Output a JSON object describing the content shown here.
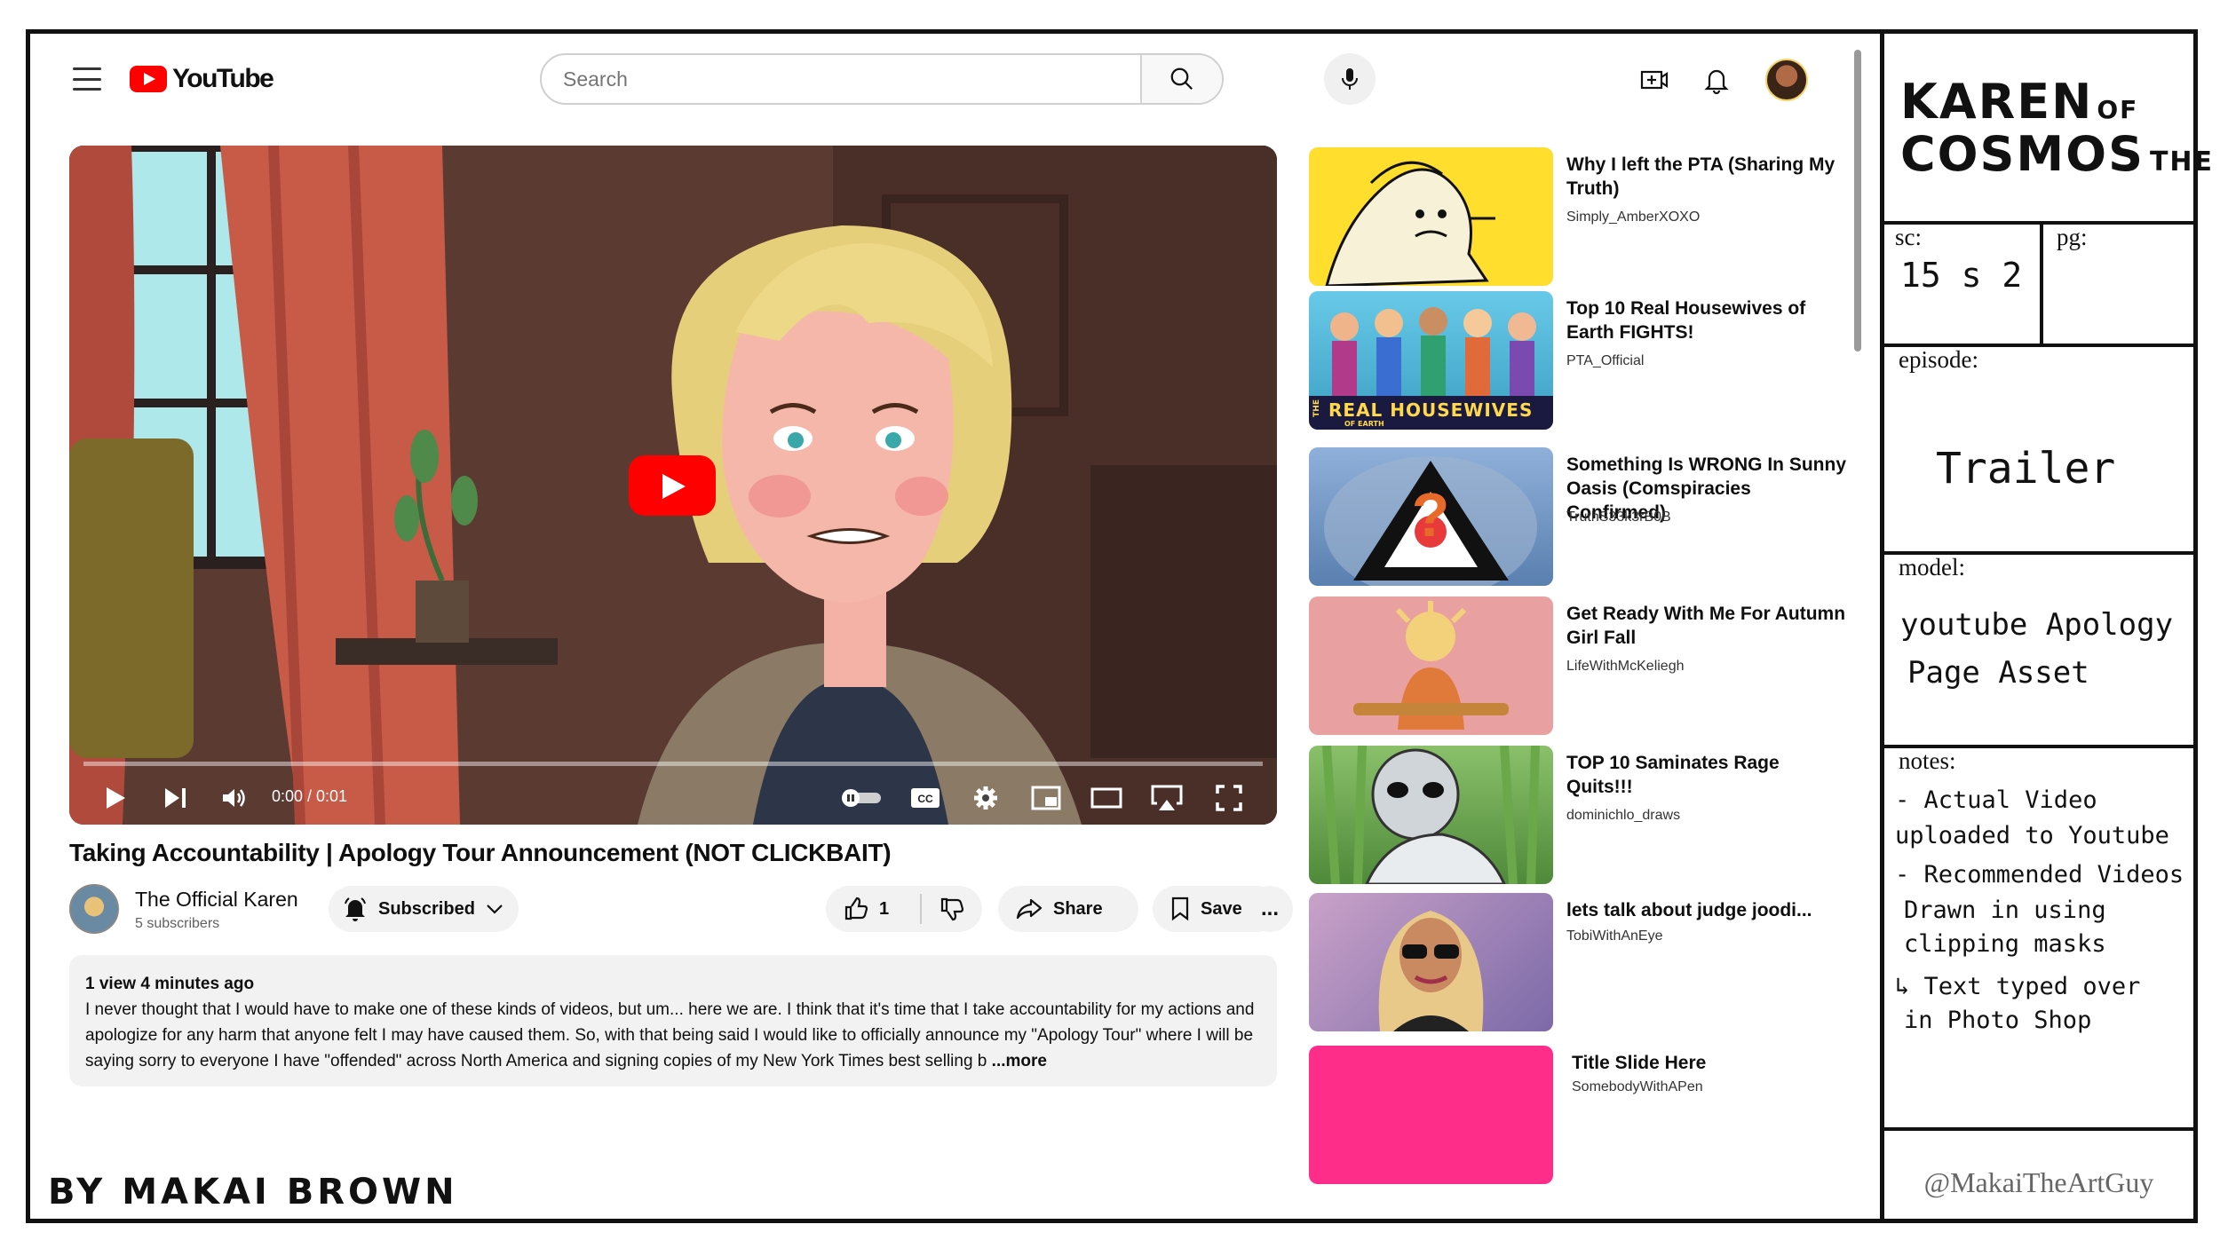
{
  "header": {
    "logo_text": "YouTube",
    "search_placeholder": "Search"
  },
  "player": {
    "time": "0:00 / 0:01"
  },
  "video": {
    "title": "Taking Accountability | Apology Tour Announcement (NOT CLICKBAIT)",
    "channel": "The Official Karen",
    "subscribers": "5 subscribers",
    "subscribe_label": "Subscribed",
    "likes": "1",
    "share_label": "Share",
    "save_label": "Save",
    "more_label": "...",
    "description_meta": "1 view  4 minutes ago",
    "description_text": "I never thought that I would have to make one of these kinds of videos, but um... here we are. I think that it's time that I take accountability for my actions and apologize for any harm that anyone felt I may have caused them. So, with that being said I would like to officially announce my \"Apology Tour\" where I will be saying sorry to everyone I have \"offended\" across North America and signing copies of my New York Times best selling b",
    "description_more": "...more"
  },
  "recommended": [
    {
      "title": "Why I left the PTA (Sharing My Truth)",
      "channel": "Simply_AmberXOXO"
    },
    {
      "title": "Top 10 Real Housewives of Earth FIGHTS!",
      "channel": "PTA_Official",
      "thumb_text": "REAL HOUSEWIVES",
      "thumb_side_text": "THE",
      "thumb_sub_text": "OF EARTH"
    },
    {
      "title": "Something Is WRONG In Sunny Oasis (Comspiracies Confirmed)",
      "channel": "TruthS33k3rB0B"
    },
    {
      "title": "Get Ready With Me For Autumn Girl Fall",
      "channel": "LifeWithMcKeliegh"
    },
    {
      "title": "TOP 10 Saminates Rage Quits!!!",
      "channel": "dominichlo_draws"
    },
    {
      "title": "lets talk about judge joodi...",
      "channel": "TobiWithAnEye"
    },
    {
      "title": "Title Slide Here",
      "channel": "SomebodyWithAPen"
    }
  ],
  "byline": "BY MAKAI BROWN",
  "panel": {
    "logo_line1": "KAREN",
    "logo_line2": "COSMOS",
    "logo_of": "OF",
    "logo_the": "THE",
    "sc_label": "sc:",
    "sc_value": "15 s 2",
    "pg_label": "pg:",
    "episode_label": "episode:",
    "episode_value": "Trailer",
    "model_label": "model:",
    "model_line1": "youtube Apology",
    "model_line2": "Page  Asset",
    "notes_label": "notes:",
    "notes_lines": [
      "- Actual Video",
      "uploaded to Youtube",
      "- Recommended Videos",
      "Drawn in using",
      "clipping masks",
      "↳ Text typed over",
      "in  Photo Shop"
    ],
    "handle": "@MakaiTheArtGuy"
  },
  "colors": {
    "youtube_red": "#ff0000",
    "pink_slide": "#ff2d8a",
    "thumb_yellow": "#ffde2e"
  }
}
